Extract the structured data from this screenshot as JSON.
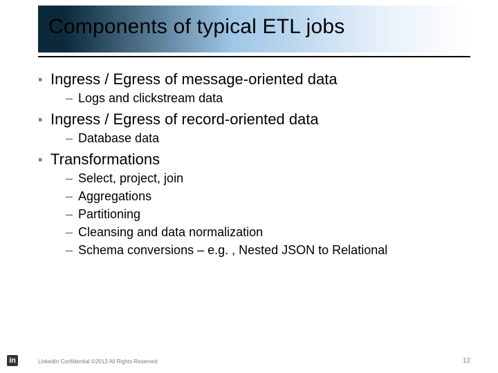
{
  "title": "Components of typical ETL jobs",
  "b1": {
    "text": "Ingress / Egress of message-oriented data",
    "sub": [
      "Logs and clickstream data"
    ]
  },
  "b2": {
    "text": "Ingress / Egress of record-oriented data",
    "sub": [
      "Database data"
    ]
  },
  "b3": {
    "text": "Transformations",
    "sub": [
      "Select, project, join",
      "Aggregations",
      "Partitioning",
      "Cleansing and data normalization",
      "Schema conversions – e.g. , Nested JSON to Relational"
    ]
  },
  "footer": {
    "copyright": "LinkedIn Confidential ©2013 All Rights Reserved",
    "page": "12"
  },
  "logo": "in",
  "glyph": {
    "square": "▪",
    "dash": "–"
  }
}
